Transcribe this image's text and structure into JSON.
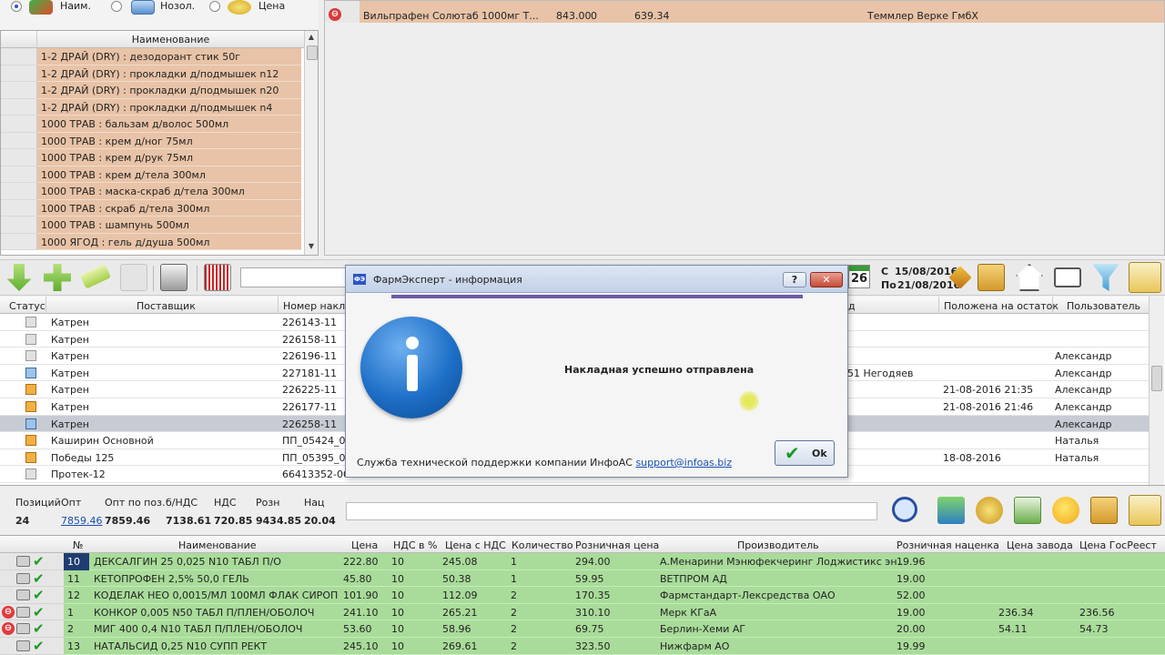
{
  "search_mode": {
    "options": [
      {
        "label": "Наим.",
        "icon": "pills-icon",
        "selected": true
      },
      {
        "label": "Нозол.",
        "icon": "monitor-icon",
        "selected": false
      },
      {
        "label": "Цена",
        "icon": "coins-icon",
        "selected": false
      }
    ]
  },
  "product_list": {
    "header": "Наименование",
    "items": [
      "1-2 ДРАЙ (DRY) : дезодорант стик 50г",
      "1-2 ДРАЙ (DRY) : прокладки д/подмышек n12",
      "1-2 ДРАЙ (DRY) : прокладки д/подмышек n20",
      "1-2 ДРАЙ (DRY) : прокладки д/подмышек n4",
      "1000 ТРАВ : бальзам д/волос 500мл",
      "1000 ТРАВ : крем д/ног 75мл",
      "1000 ТРАВ : крем д/рук 75мл",
      "1000 ТРАВ : крем д/тела 300мл",
      "1000 ТРАВ : маска-скраб д/тела 300мл",
      "1000 ТРАВ : скраб д/тела 300мл",
      "1000 ТРАВ : шампунь 500мл",
      "1000 ЯГОД : гель д/душа 500мл"
    ]
  },
  "offers": {
    "rows": [
      {
        "name": "Вильпрафен Солютаб 1000мг Т...",
        "price": "843.00",
        "qty": "0",
        "price2": "639.34",
        "maker": "Теммлер Верке ГмбХ"
      }
    ]
  },
  "date_filter": {
    "calendar_day": "26",
    "from_label": "С",
    "from_date": "15/08/2016",
    "to_label": "По",
    "to_date": "21/08/2016"
  },
  "invoices": {
    "columns": [
      "Статус",
      "Поставщик",
      "Номер накла",
      "д",
      "Положена на остаток",
      "Пользователь"
    ],
    "rows": [
      {
        "status": "doc",
        "supplier": "Катрен",
        "number": "226143-11",
        "extra": "",
        "posted": "",
        "user": ""
      },
      {
        "status": "doc",
        "supplier": "Катрен",
        "number": "226158-11",
        "extra": "",
        "posted": "",
        "user": ""
      },
      {
        "status": "doc",
        "supplier": "Катрен",
        "number": "226196-11",
        "extra": "",
        "posted": "",
        "user": "Александр"
      },
      {
        "status": "env",
        "supplier": "Катрен",
        "number": "227181-11",
        "extra": "51 Негодяев",
        "posted": "",
        "user": "Александр"
      },
      {
        "status": "box",
        "supplier": "Катрен",
        "number": "226225-11",
        "extra": "",
        "posted": "21-08-2016 21:35",
        "user": "Александр"
      },
      {
        "status": "box",
        "supplier": "Катрен",
        "number": "226177-11",
        "extra": "",
        "posted": "21-08-2016 21:46",
        "user": "Александр"
      },
      {
        "status": "env",
        "supplier": "Катрен",
        "number": "226258-11",
        "extra": "",
        "posted": "",
        "user": "Александр",
        "selected": true
      },
      {
        "status": "box",
        "supplier": "Каширин Основной",
        "number": "ПП_05424_00",
        "extra": "",
        "posted": "",
        "user": "Наталья"
      },
      {
        "status": "box",
        "supplier": "Победы 125",
        "number": "ПП_05395_00",
        "extra": "",
        "posted": "18-08-2016",
        "user": "Наталья"
      },
      {
        "status": "doc",
        "supplier": "Протек-12",
        "number": "66413352-001",
        "extra": "",
        "posted": "",
        "user": ""
      }
    ]
  },
  "summary": {
    "labels": {
      "positions": "Позиций",
      "opt": "Опт",
      "opt_by_pos": "Опт по поз.",
      "no_vat": "б/НДС",
      "vat": "НДС",
      "retail": "Розн",
      "markup": "Нац"
    },
    "values": {
      "positions": "24",
      "opt": "7859.46",
      "opt_by_pos": "7859.46",
      "no_vat": "7138.61",
      "vat": "720.85",
      "retail": "9434.85",
      "markup": "20.04"
    }
  },
  "goods": {
    "columns": [
      "№",
      "Наименование",
      "Цена",
      "НДС в %",
      "Цена с НДС",
      "Количество",
      "Розничная цена",
      "Производитель",
      "Розничная наценка",
      "Цена завода",
      "Цена ГосРеест"
    ],
    "rows": [
      {
        "num": "10",
        "name": "ДЕКСАЛГИН 25 0,025 N10 ТАБЛ П/О",
        "price": "222.80",
        "vat": "10",
        "price_vat": "245.08",
        "qty": "1",
        "retail": "294.00",
        "maker": "А.Менарини Мэнюфекчеринг Лоджистикс эн...",
        "markup": "19.96",
        "factory": "",
        "gosreestr": "",
        "error": false,
        "selected": true
      },
      {
        "num": "11",
        "name": "КЕТОПРОФЕН 2,5% 50,0 ГЕЛЬ",
        "price": "45.80",
        "vat": "10",
        "price_vat": "50.38",
        "qty": "1",
        "retail": "59.95",
        "maker": "ВЕТПРОМ АД",
        "markup": "19.00",
        "factory": "",
        "gosreestr": "",
        "error": false,
        "selected": false
      },
      {
        "num": "12",
        "name": "КОДЕЛАК НЕО 0,0015/МЛ 100МЛ ФЛАК СИРОП",
        "price": "101.90",
        "vat": "10",
        "price_vat": "112.09",
        "qty": "2",
        "retail": "170.35",
        "maker": "Фармстандарт-Лексредства ОАО",
        "markup": "52.00",
        "factory": "",
        "gosreestr": "",
        "error": false,
        "selected": false
      },
      {
        "num": "1",
        "name": "КОНКОР 0,005 N50 ТАБЛ П/ПЛЕН/ОБОЛОЧ",
        "price": "241.10",
        "vat": "10",
        "price_vat": "265.21",
        "qty": "2",
        "retail": "310.10",
        "maker": "Мерк КГаА",
        "markup": "19.00",
        "factory": "236.34",
        "gosreestr": "236.56",
        "error": true,
        "selected": false
      },
      {
        "num": "2",
        "name": "МИГ 400 0,4 N10 ТАБЛ П/ПЛЕН/ОБОЛОЧ",
        "price": "53.60",
        "vat": "10",
        "price_vat": "58.96",
        "qty": "2",
        "retail": "69.75",
        "maker": "Берлин-Хеми АГ",
        "markup": "20.00",
        "factory": "54.11",
        "gosreestr": "54.73",
        "error": true,
        "selected": false
      },
      {
        "num": "13",
        "name": "НАТАЛЬСИД 0,25 N10 СУПП РЕКТ",
        "price": "245.10",
        "vat": "10",
        "price_vat": "269.61",
        "qty": "2",
        "retail": "323.50",
        "maker": "Нижфарм АО",
        "markup": "19.99",
        "factory": "",
        "gosreestr": "",
        "error": false,
        "selected": false
      }
    ]
  },
  "dialog": {
    "app_icon": "ФЭ",
    "title": "ФармЭксперт - информация",
    "help_label": "?",
    "close_label": "✕",
    "message": "Накладная успешно отправлена",
    "support_text": "Служба технической поддержки компании ИнфоАС",
    "support_link": "support@infoas.biz",
    "ok_label": "Ok"
  },
  "colors": {
    "product_row": "#e8c3a7",
    "goods_row": "#a9dc9a",
    "selected_row": "#c7cbd4",
    "link": "#1a4fb0"
  }
}
